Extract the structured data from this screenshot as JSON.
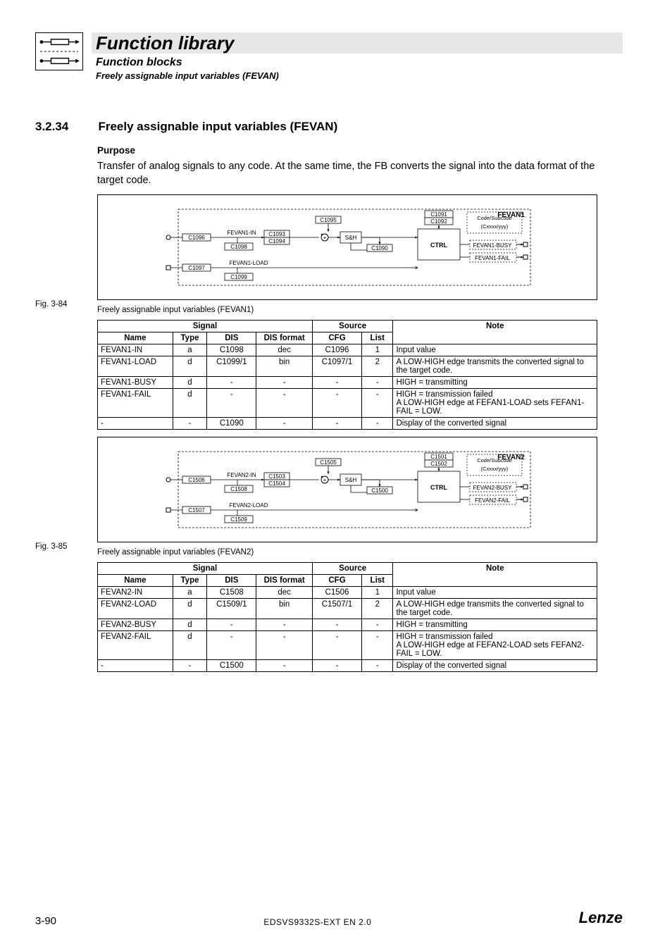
{
  "header": {
    "title": "Function library",
    "subtitle": "Function blocks",
    "subtitle2": "Freely assignable input variables (FEVAN)"
  },
  "section": {
    "number": "3.2.34",
    "title": "Freely assignable input variables (FEVAN)"
  },
  "purpose": {
    "heading": "Purpose",
    "text": "Transfer of analog signals to any code. At the same time, the FB converts the signal into the data format of the target code."
  },
  "fig1": {
    "num": "Fig. 3-84",
    "caption": "Freely assignable input variables (FEVAN1)",
    "block": {
      "name": "FEVAN1",
      "codeA": "C1091",
      "codeB": "C1092",
      "subcode_lbl": "Code/Subcode",
      "subcode_fmt": "(Cxxxx/yyy)",
      "in_lbl": "FEVAN1-IN",
      "in_cfg": "C1096",
      "in_num": "C1093",
      "in_den": "C1094",
      "in_dis": "C1098",
      "offset": "C1095",
      "sh": "S&H",
      "ctrl_dis": "C1090",
      "ctrl": "CTRL",
      "load_lbl": "FEVAN1-LOAD",
      "load_cfg": "C1097",
      "load_dis": "C1099",
      "busy": "FEVAN1-BUSY",
      "fail": "FEVAN1-FAIL"
    }
  },
  "table_headers": {
    "signal": "Signal",
    "source": "Source",
    "note": "Note",
    "name": "Name",
    "type": "Type",
    "dis": "DIS",
    "disfmt": "DIS format",
    "cfg": "CFG",
    "list": "List"
  },
  "table1": {
    "rows": [
      {
        "name": "FEVAN1-IN",
        "type": "a",
        "dis": "C1098",
        "disfmt": "dec",
        "cfg": "C1096",
        "list": "1",
        "note": "Input value"
      },
      {
        "name": "FEVAN1-LOAD",
        "type": "d",
        "dis": "C1099/1",
        "disfmt": "bin",
        "cfg": "C1097/1",
        "list": "2",
        "note": "A LOW-HIGH edge transmits the converted signal to the target code."
      },
      {
        "name": "FEVAN1-BUSY",
        "type": "d",
        "dis": "-",
        "disfmt": "-",
        "cfg": "-",
        "list": "-",
        "note": "HIGH = transmitting"
      },
      {
        "name": "FEVAN1-FAIL",
        "type": "d",
        "dis": "-",
        "disfmt": "-",
        "cfg": "-",
        "list": "-",
        "note": "HIGH = transmission failed\nA LOW-HIGH edge at FEFAN1-LOAD sets FEFAN1-FAIL = LOW."
      },
      {
        "name": "-",
        "type": "-",
        "dis": "C1090",
        "disfmt": "-",
        "cfg": "-",
        "list": "-",
        "note": "Display of the converted signal"
      }
    ]
  },
  "fig2": {
    "num": "Fig. 3-85",
    "caption": "Freely assignable input variables (FEVAN2)",
    "block": {
      "name": "FEVAN2",
      "codeA": "C1501",
      "codeB": "C1502",
      "subcode_lbl": "Code/Subcode",
      "subcode_fmt": "(Cxxxx/yyy)",
      "in_lbl": "FEVAN2-IN",
      "in_cfg": "C1506",
      "in_num": "C1503",
      "in_den": "C1504",
      "in_dis": "C1508",
      "offset": "C1505",
      "sh": "S&H",
      "ctrl_dis": "C1500",
      "ctrl": "CTRL",
      "load_lbl": "FEVAN2-LOAD",
      "load_cfg": "C1507",
      "load_dis": "C1509",
      "busy": "FEVAN2-BUSY",
      "fail": "FEVAN2-FAIL"
    }
  },
  "table2": {
    "rows": [
      {
        "name": "FEVAN2-IN",
        "type": "a",
        "dis": "C1508",
        "disfmt": "dec",
        "cfg": "C1506",
        "list": "1",
        "note": "Input value"
      },
      {
        "name": "FEVAN2-LOAD",
        "type": "d",
        "dis": "C1509/1",
        "disfmt": "bin",
        "cfg": "C1507/1",
        "list": "2",
        "note": "A LOW-HIGH edge transmits the converted signal to the target code."
      },
      {
        "name": "FEVAN2-BUSY",
        "type": "d",
        "dis": "-",
        "disfmt": "-",
        "cfg": "-",
        "list": "-",
        "note": "HIGH = transmitting"
      },
      {
        "name": "FEVAN2-FAIL",
        "type": "d",
        "dis": "-",
        "disfmt": "-",
        "cfg": "-",
        "list": "-",
        "note": "HIGH = transmission failed\nA LOW-HIGH edge at FEFAN2-LOAD sets FEFAN2-FAIL = LOW."
      },
      {
        "name": "-",
        "type": "-",
        "dis": "C1500",
        "disfmt": "-",
        "cfg": "-",
        "list": "-",
        "note": "Display of the converted signal"
      }
    ]
  },
  "footer": {
    "page": "3-90",
    "doc": "EDSVS9332S-EXT EN 2.0",
    "brand": "Lenze"
  },
  "chart_data": null
}
